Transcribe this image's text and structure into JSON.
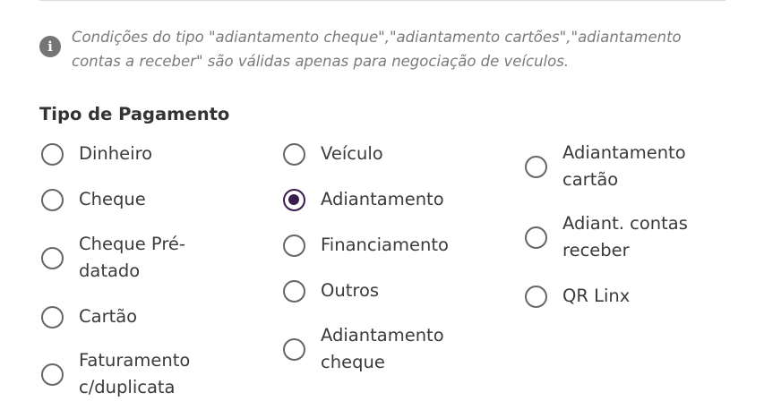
{
  "notice": {
    "icon": "info-icon",
    "text": "Condições do tipo \"adiantamento cheque\",\"adiantamento cartões\",\"adiantamento contas a receber\" são válidas apenas para negociação de veículos."
  },
  "payment_type": {
    "label": "Tipo de Pagamento",
    "selected": "Adiantamento",
    "options": [
      {
        "label": "Dinheiro"
      },
      {
        "label": "Cheque"
      },
      {
        "label": "Cheque Pré-datado"
      },
      {
        "label": "Cartão"
      },
      {
        "label": "Faturamento c/duplicata"
      },
      {
        "label": "Veículo"
      },
      {
        "label": "Adiantamento"
      },
      {
        "label": "Financiamento"
      },
      {
        "label": "Outros"
      },
      {
        "label": "Adiantamento cheque"
      },
      {
        "label": "Adiantamento cartão"
      },
      {
        "label": "Adiant. contas receber"
      },
      {
        "label": "QR Linx"
      }
    ]
  },
  "colors": {
    "accent": "#3a1c4f",
    "radio_border": "#666666",
    "notice_text": "#7a7a7a"
  }
}
